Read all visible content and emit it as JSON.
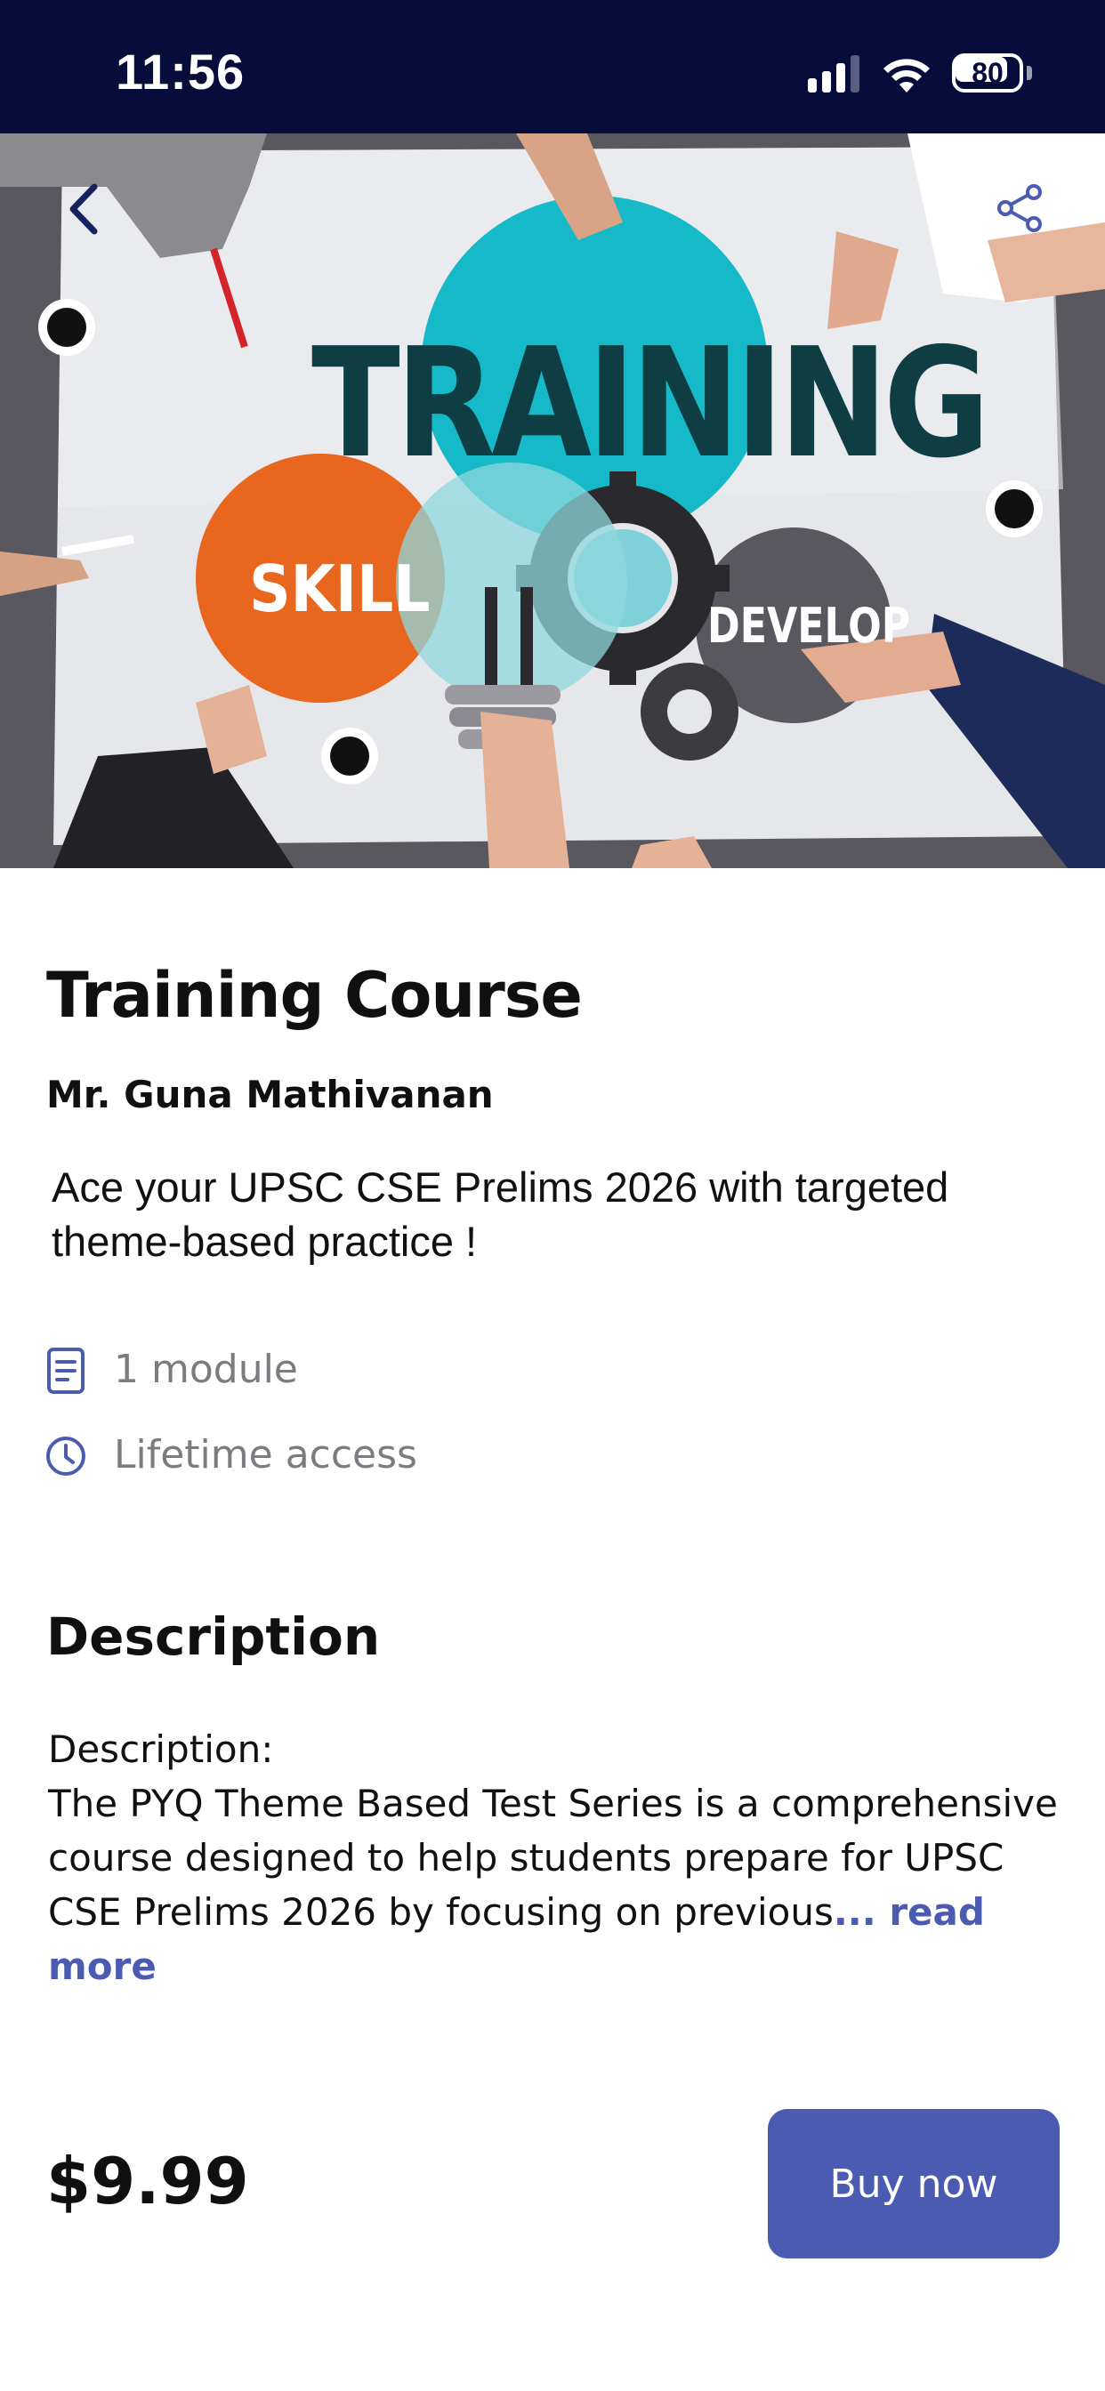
{
  "status_bar": {
    "time": "11:56",
    "battery": "80",
    "signal_icon": "cellular-signal-icon",
    "wifi_icon": "wifi-icon",
    "battery_icon": "battery-icon"
  },
  "hero": {
    "image_text_main": "TRAINING",
    "image_text_left": "SKILL",
    "image_text_right": "DEVELOP",
    "back_icon": "chevron-left-icon",
    "share_icon": "share-icon"
  },
  "course": {
    "title": "Training Course",
    "instructor": "Mr. Guna Mathivanan",
    "tagline": "Ace your UPSC CSE Prelims 2026 with targeted theme-based practice !",
    "meta": [
      {
        "icon": "document-icon",
        "label": "1 module"
      },
      {
        "icon": "clock-icon",
        "label": "Lifetime access"
      }
    ]
  },
  "description": {
    "heading": "Description",
    "line1": "Description:",
    "body": "The PYQ Theme Based Test Series is a comprehensive course designed to help students prepare for UPSC CSE Prelims 2026 by focusing on previous",
    "read_more": "... read more"
  },
  "purchase": {
    "price": "$9.99",
    "buy_label": "Buy now"
  },
  "colors": {
    "status_bar_bg": "#070d3b",
    "accent": "#4b5bb1",
    "muted_text": "#7b7b80"
  }
}
